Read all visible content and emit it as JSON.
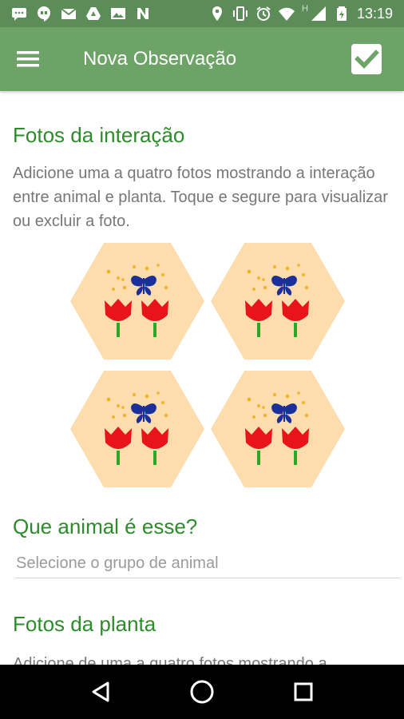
{
  "status_bar": {
    "time": "13:19",
    "left_icons": [
      "messages-icon",
      "hangouts-icon",
      "gmail-icon",
      "drive-icon",
      "photos-icon",
      "n-icon"
    ],
    "right_icons": [
      "location-icon",
      "vibrate-icon",
      "alarm-icon",
      "wifi-icon",
      "h-signal-icon",
      "battery-icon"
    ],
    "network_label": "H"
  },
  "app_bar": {
    "title": "Nova Observação",
    "menu_icon": "hamburger-menu-icon",
    "confirm_icon": "check-icon"
  },
  "sections": {
    "interaction_photos": {
      "title": "Fotos da interação",
      "description": "Adicione uma a quatro fotos mostrando a interação entre animal e planta. Toque e segure para visualizar ou excluir a foto.",
      "placeholders": [
        "photo-placeholder-1",
        "photo-placeholder-2",
        "photo-placeholder-3",
        "photo-placeholder-4"
      ]
    },
    "animal": {
      "title": "Que animal é esse?",
      "select_placeholder": "Selecione o grupo de animal"
    },
    "plant_photos": {
      "title": "Fotos da planta",
      "description": "Adicione de uma a quatro fotos mostrando a"
    }
  },
  "nav_bar": {
    "buttons": [
      "back-icon",
      "home-icon",
      "recents-icon"
    ]
  },
  "colors": {
    "status_bar": "#5c8d58",
    "app_bar": "#6ea368",
    "section_title": "#2e8b2b",
    "hex_fill": "#fddcae",
    "tulip": "#e8141a",
    "stem": "#2ea62a",
    "butterfly": "#1a2f9a",
    "pollen": "#f0b52a"
  }
}
